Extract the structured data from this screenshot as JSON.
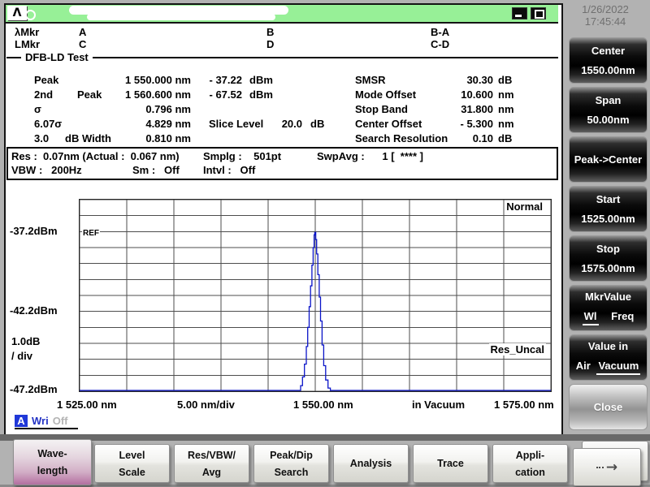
{
  "titlebar": {
    "logo": "Λ"
  },
  "clock": {
    "date": "1/26/2022",
    "time": "17:45:44"
  },
  "markers": {
    "row1": {
      "name": "λMkr",
      "a": "A",
      "b": "B",
      "diff": "B-A"
    },
    "row2": {
      "name": "LMkr",
      "a": "C",
      "b": "D",
      "diff": "C-D"
    }
  },
  "test_name": "DFB-LD Test",
  "results": {
    "peak": {
      "label": "Peak",
      "wl": "1 550.000 nm",
      "lvl": "- 37.22",
      "unit": "dBm"
    },
    "peak2": {
      "label": "2nd",
      "label2": "Peak",
      "wl": "1 560.600 nm",
      "lvl": "- 67.52",
      "unit": "dBm"
    },
    "sigma": {
      "label": "σ",
      "wl": "0.796 nm"
    },
    "sigma6": {
      "label": "6.07σ",
      "wl": "4.829 nm",
      "slice_label": "Slice Level",
      "slice_value": "20.0",
      "slice_unit": "dB"
    },
    "width3db": {
      "label": "3.0",
      "label2": "dB Width",
      "wl": "0.810 nm"
    },
    "smsr": {
      "label": "SMSR",
      "value": "30.30",
      "unit": "dB"
    },
    "mode_offset": {
      "label": "Mode Offset",
      "value": "10.600",
      "unit": "nm"
    },
    "stop_band": {
      "label": "Stop Band",
      "value": "31.800",
      "unit": "nm"
    },
    "center_offset": {
      "label": "Center Offset",
      "value": "- 5.300",
      "unit": "nm"
    },
    "search_res": {
      "label": "Search Resolution",
      "value": "0.10",
      "unit": "dB"
    }
  },
  "acquisition": {
    "res": "Res :  0.07nm (Actual :  0.067 nm)",
    "smplg": "Smplg :    501pt",
    "swpavg": "SwpAvg :      1 [  **** ]",
    "vbw": "VBW :   200Hz",
    "sm": "Sm :   Off",
    "intvl": "Intvl :   Off"
  },
  "chart_data": {
    "type": "line",
    "title": "Optical spectrum trace A (DFB-LD Test)",
    "x_axis": {
      "start_label": "1 525.00 nm",
      "div_label": "5.00 nm/div",
      "center_label": "1 550.00 nm",
      "medium_label": "in Vacuum",
      "end_label": "1 575.00 nm",
      "range_nm": [
        1525,
        1575
      ],
      "divisions": 10
    },
    "y_axis": {
      "ref_label": "-37.2dBm",
      "mid_label": "-42.2dBm",
      "bottom_label": "-47.2dBm",
      "per_div_label": "1.0dB",
      "per_div_label2": "/ div",
      "top_dbm": -35.2,
      "ref_dbm": -37.2,
      "bottom_dbm": -47.2,
      "divisions": 12
    },
    "annotations": {
      "ref": "REF",
      "mode": "Normal",
      "res_uncal": "Res_Uncal"
    },
    "grid": true,
    "trace_color": "#0a14c8",
    "series": [
      {
        "name": "Trace A",
        "points": [
          [
            1525.0,
            -47.15
          ],
          [
            1548.2,
            -47.15
          ],
          [
            1548.45,
            -46.85
          ],
          [
            1548.65,
            -46.3
          ],
          [
            1548.85,
            -45.5
          ],
          [
            1549.05,
            -44.4
          ],
          [
            1549.2,
            -43.2
          ],
          [
            1549.35,
            -41.9
          ],
          [
            1549.5,
            -40.6
          ],
          [
            1549.65,
            -39.3
          ],
          [
            1549.78,
            -38.2
          ],
          [
            1549.88,
            -37.4
          ],
          [
            1549.95,
            -37.25
          ],
          [
            1550.05,
            -37.7
          ],
          [
            1550.15,
            -38.6
          ],
          [
            1550.28,
            -39.9
          ],
          [
            1550.42,
            -41.3
          ],
          [
            1550.56,
            -42.8
          ],
          [
            1550.72,
            -44.3
          ],
          [
            1550.9,
            -45.6
          ],
          [
            1551.1,
            -46.5
          ],
          [
            1551.35,
            -47.0
          ],
          [
            1551.6,
            -47.15
          ],
          [
            1575.0,
            -47.15
          ]
        ]
      }
    ]
  },
  "trace_status": {
    "slot": "A",
    "mode": "Wri",
    "state": "Off"
  },
  "sidebar": {
    "buttons": [
      {
        "line1": "Center",
        "line2": "1550.00nm"
      },
      {
        "line1": "Span",
        "line2": "50.00nm"
      },
      {
        "line1": "Peak->Center",
        "line2": ""
      },
      {
        "line1": "Start",
        "line2": "1525.00nm"
      },
      {
        "line1": "Stop",
        "line2": "1575.00nm"
      },
      {
        "line1": "MkrValue",
        "opt1": "Wl",
        "opt2": "Freq",
        "selected": "Wl"
      },
      {
        "line1": "Value in",
        "opt1": "Air",
        "opt2": "Vacuum",
        "selected": "Vacuum"
      },
      {
        "line1": "Close",
        "line2": ""
      }
    ]
  },
  "toolbar": {
    "buttons": [
      {
        "line1": "Wave-",
        "line2": "length",
        "active": true
      },
      {
        "line1": "Level",
        "line2": "Scale"
      },
      {
        "line1": "Res/VBW/",
        "line2": "Avg"
      },
      {
        "line1": "Peak/Dip",
        "line2": "Search"
      },
      {
        "line1": "Analysis",
        "line2": ""
      },
      {
        "line1": "Trace",
        "line2": ""
      },
      {
        "line1": "Appli-",
        "line2": "cation"
      },
      {
        "line1": "→",
        "line2": ""
      }
    ]
  }
}
